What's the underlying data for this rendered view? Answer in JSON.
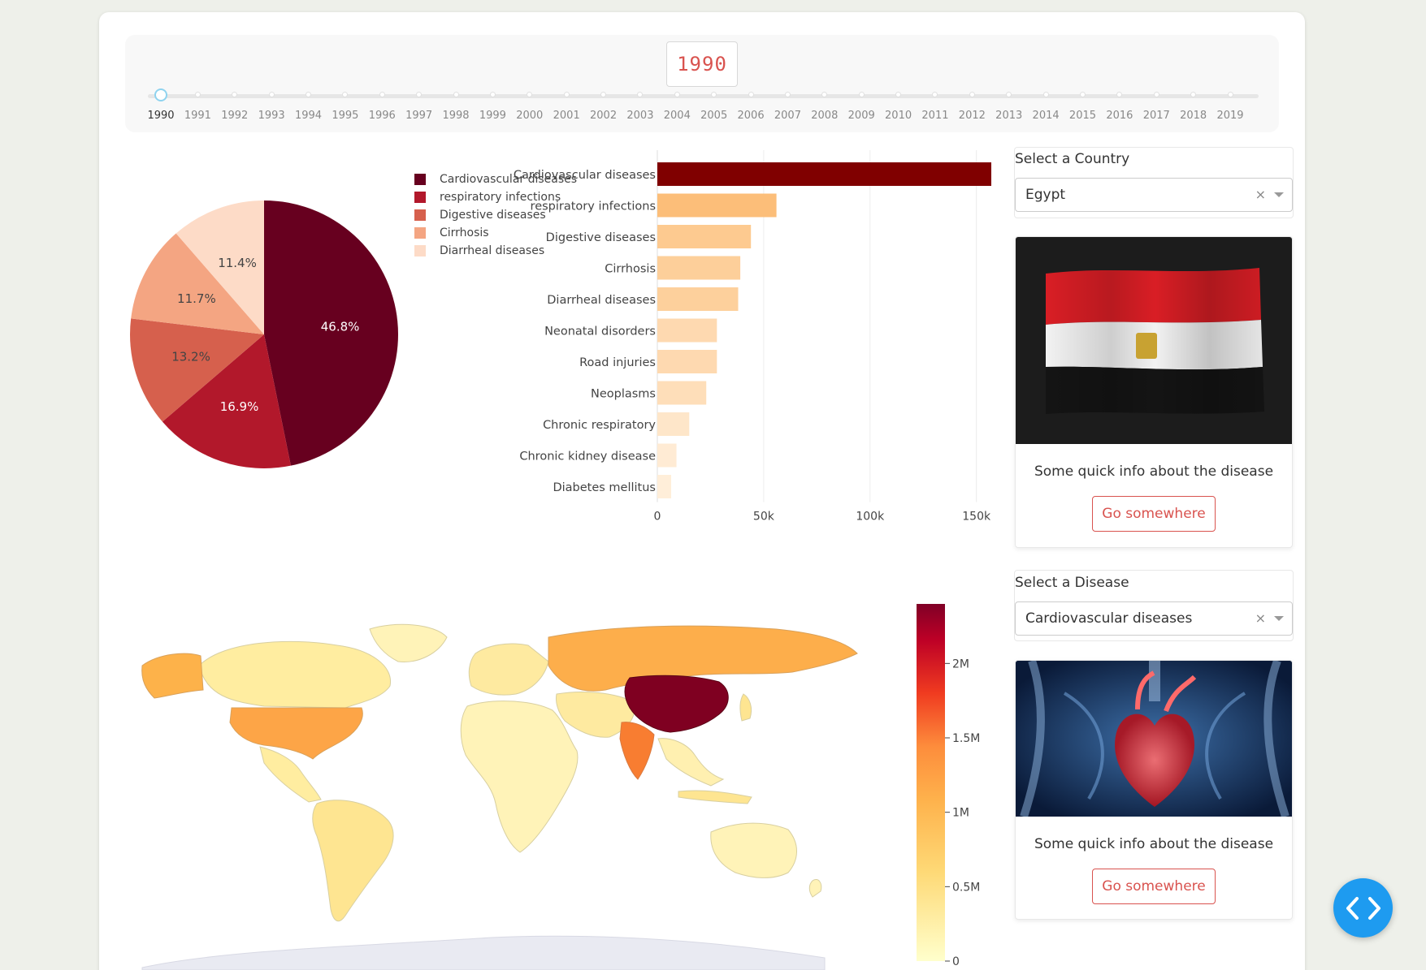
{
  "timeline": {
    "current_year": "1990",
    "years": [
      "1990",
      "1991",
      "1992",
      "1993",
      "1994",
      "1995",
      "1996",
      "1997",
      "1998",
      "1999",
      "2000",
      "2001",
      "2002",
      "2003",
      "2004",
      "2005",
      "2006",
      "2007",
      "2008",
      "2009",
      "2010",
      "2011",
      "2012",
      "2013",
      "2014",
      "2015",
      "2016",
      "2017",
      "2018",
      "2019"
    ]
  },
  "pie_chart": {
    "slices": [
      {
        "label": "Cardiovascular diseases",
        "percent": 46.8,
        "text": "46.8%",
        "color": "#67001f"
      },
      {
        "label": "respiratory infections",
        "percent": 16.9,
        "text": "16.9%",
        "color": "#b2182b"
      },
      {
        "label": "Digestive diseases",
        "percent": 13.2,
        "text": "13.2%",
        "color": "#d6604d"
      },
      {
        "label": "Cirrhosis",
        "percent": 11.7,
        "text": "11.7%",
        "color": "#f4a582"
      },
      {
        "label": "Diarrheal diseases",
        "percent": 11.4,
        "text": "11.4%",
        "color": "#fddbc7"
      }
    ]
  },
  "chart_data": [
    {
      "type": "pie",
      "categories": [
        "Cardiovascular diseases",
        "respiratory infections",
        "Digestive diseases",
        "Cirrhosis",
        "Diarrheal diseases"
      ],
      "values": [
        46.8,
        16.9,
        13.2,
        11.7,
        11.4
      ],
      "legend": "top-right"
    },
    {
      "type": "bar",
      "orientation": "horizontal",
      "categories": [
        "Cardiovascular diseases",
        "respiratory infections",
        "Digestive diseases",
        "Cirrhosis",
        "Diarrheal diseases",
        "Neonatal disorders",
        "Road injuries",
        "Neoplasms",
        "Chronic respiratory",
        "Chronic kidney disease",
        "Diabetes mellitus"
      ],
      "values": [
        157000,
        56000,
        44000,
        39000,
        38000,
        28000,
        28000,
        23000,
        15000,
        9000,
        6500
      ],
      "xlim": [
        0,
        157000
      ],
      "xticks": [
        "0",
        "50k",
        "100k",
        "150k"
      ],
      "xtick_values": [
        0,
        50000,
        100000,
        150000
      ],
      "grid": true
    },
    {
      "type": "choropleth",
      "colorbar": {
        "ticks": [
          "2M",
          "1.5M",
          "1M",
          "0.5M",
          "0"
        ],
        "tick_values": [
          2000000,
          1500000,
          1000000,
          500000,
          0
        ],
        "range": [
          0,
          2400000
        ]
      },
      "notable": [
        {
          "region": "China",
          "level": "2.4M"
        },
        {
          "region": "India",
          "level": "1.3M"
        },
        {
          "region": "Russia",
          "level": "0.85M"
        },
        {
          "region": "United States",
          "level": "0.8M"
        }
      ]
    }
  ],
  "sidebar": {
    "country_label": "Select a Country",
    "country_value": "Egypt",
    "country_info": "Some quick info about the disease",
    "country_button": "Go somewhere",
    "disease_label": "Select a Disease",
    "disease_value": "Cardiovascular diseases",
    "disease_info": "Some quick info about the disease",
    "disease_button": "Go somewhere",
    "clear_glyph": "×"
  },
  "colors": {
    "accent_red": "#d9534f",
    "fab_blue": "#1e9bf0"
  },
  "icons": {
    "fab": "code-brackets-icon",
    "caret": "chevron-down-icon",
    "clear": "close-icon"
  }
}
